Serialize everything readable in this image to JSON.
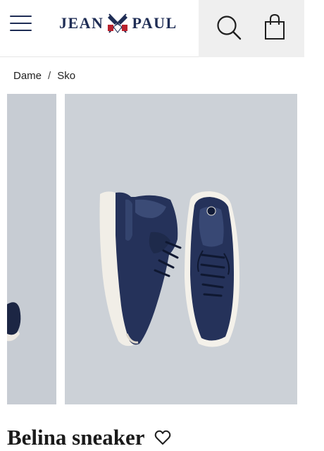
{
  "header": {
    "brand_left": "JEAN",
    "brand_right": "PAUL",
    "colors": {
      "brand_navy": "#1f2d55",
      "flag_red": "#b8222e",
      "actions_bg": "#efefef"
    }
  },
  "breadcrumb": {
    "items": [
      "Dame",
      "Sko"
    ],
    "separator": "/"
  },
  "gallery": {
    "product_color": "navy blue with white sole",
    "background_color": "#ccd1d7"
  },
  "product": {
    "title": "Belina sneaker"
  }
}
